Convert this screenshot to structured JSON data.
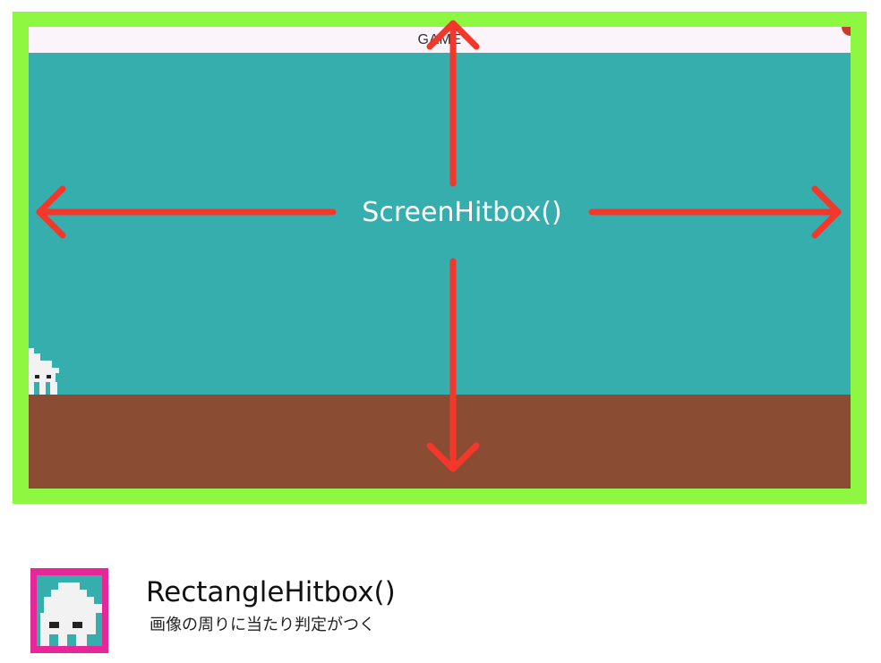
{
  "game": {
    "appbar_title": "GAME",
    "sky_color": "#37aeae",
    "ground_color": "#8a4d33",
    "appbar_color": "#fbf4fb",
    "player_sprite": "white-pixel-creature",
    "player_position": "left edge, partially cut off"
  },
  "screen_hitbox": {
    "label": "ScreenHitbox()",
    "frame_color": "#8ef741",
    "arrow_color": "#f4372b",
    "arrows": [
      "up-arrow",
      "down-arrow",
      "left-arrow",
      "right-arrow"
    ]
  },
  "rectangle_hitbox": {
    "title": "RectangleHitbox()",
    "description": "画像の周りに当たり判定がつく",
    "frame_color": "#e5279a",
    "thumbnail_sprite": "white-pixel-creature"
  }
}
